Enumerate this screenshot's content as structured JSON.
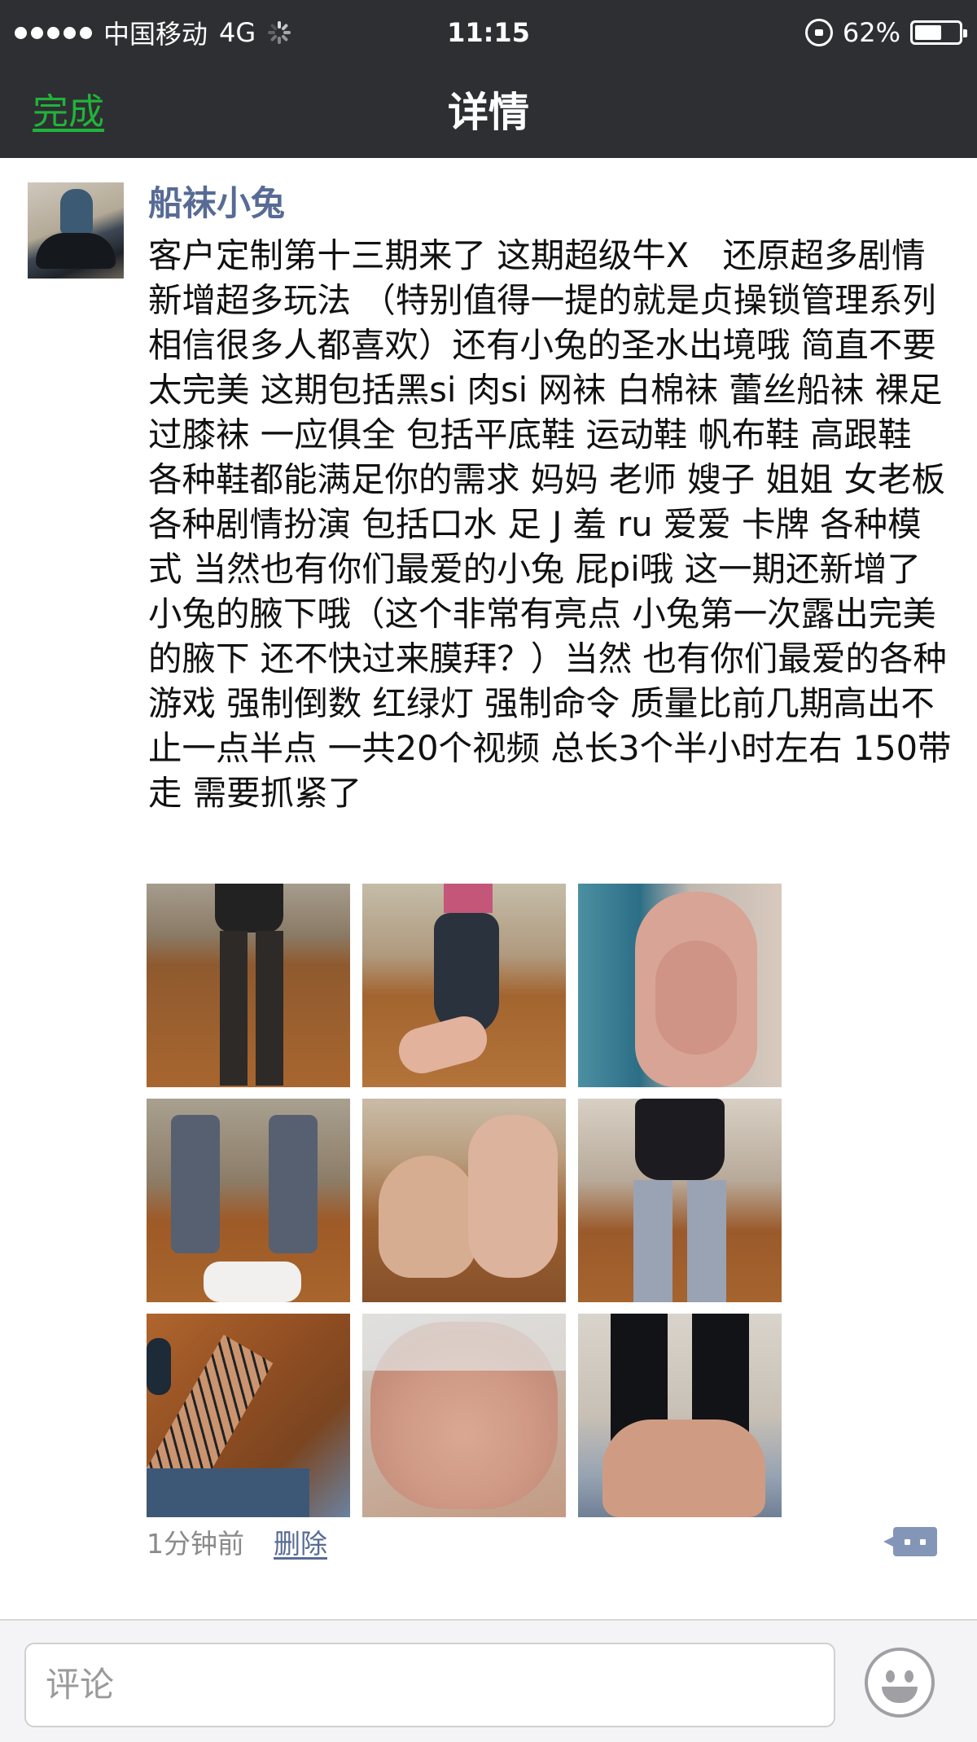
{
  "status_bar": {
    "carrier": "中国移动",
    "network": "4G",
    "time": "11:15",
    "battery": "62%",
    "battery_level": 0.62
  },
  "nav": {
    "done_label": "完成",
    "title": "详情"
  },
  "post": {
    "author": "船袜小兔",
    "text": "客户定制第十三期来了 这期超级牛X　还原超多剧情 新增超多玩法 （特别值得一提的就是贞操锁管理系列 相信很多人都喜欢）还有小兔的圣水出境哦 简直不要太完美 这期包括黑si 肉si 网袜 白棉袜 蕾丝船袜 裸足 过膝袜 一应俱全 包括平底鞋 运动鞋 帆布鞋 高跟鞋 各种鞋都能满足你的需求 妈妈 老师 嫂子 姐姐 女老板 各种剧情扮演 包括口水 足 J 羞 ru 爱爱 卡牌 各种模式 当然也有你们最爱的小兔 屁pi哦 这一期还新增了小兔的腋下哦（这个非常有亮点 小兔第一次露出完美的腋下 还不快过来膜拜？）当然 也有你们最爱的各种游戏 强制倒数 红绿灯 强制命令 质量比前几期高出不止一点半点 一共20个视频 总长3个半小时左右 150带走 需要抓紧了",
    "time": "1分钟前",
    "delete_label": "删除",
    "photos": 9
  },
  "comment_bar": {
    "placeholder": "评论"
  },
  "icons": {
    "rotation_lock": "rotation-lock-icon",
    "battery": "battery-icon",
    "comment": "comment-icon",
    "emoji": "emoji-icon"
  },
  "colors": {
    "bar_bg": "#2e2f33",
    "done_green": "#21b33a",
    "author_blue": "#576b95"
  }
}
